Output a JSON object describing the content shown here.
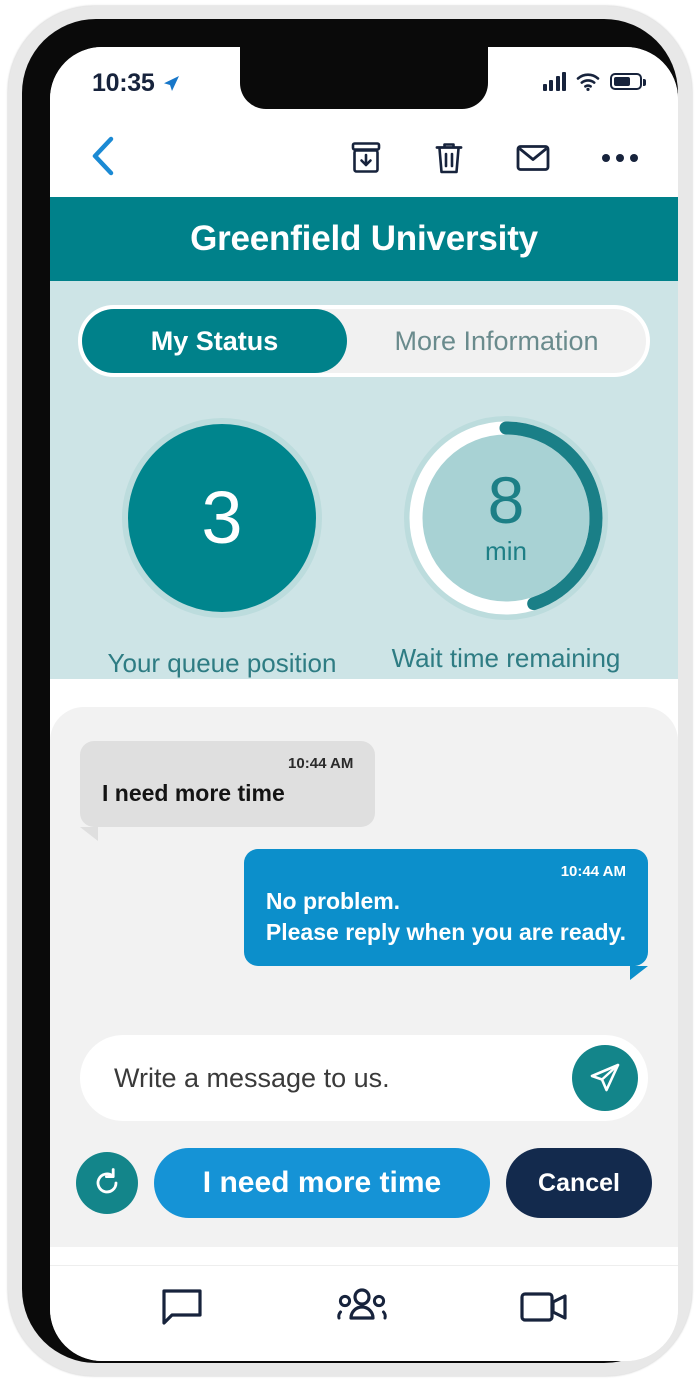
{
  "status_bar": {
    "time": "10:35",
    "location_icon": "location-arrow-icon",
    "signal_icon": "cellular-signal-icon",
    "wifi_icon": "wifi-icon",
    "battery_icon": "battery-icon"
  },
  "toolbar": {
    "back_icon": "chevron-left-icon",
    "archive_icon": "archive-box-icon",
    "delete_icon": "trash-icon",
    "mail_icon": "envelope-icon",
    "more_icon": "ellipsis-icon"
  },
  "header": {
    "title": "Greenfield University"
  },
  "tabs": [
    {
      "label": "My Status",
      "active": true
    },
    {
      "label": "More Information",
      "active": false
    }
  ],
  "metrics": [
    {
      "value": "3",
      "unit": "",
      "label": "Your queue position",
      "type": "solid"
    },
    {
      "value": "8",
      "unit": "min",
      "label": "Wait time remaining",
      "type": "ring",
      "progress_percent": 45
    }
  ],
  "chat": {
    "messages": [
      {
        "direction": "incoming",
        "time": "10:44 AM",
        "text": "I need more time"
      },
      {
        "direction": "outgoing",
        "time": "10:44 AM",
        "line1": "No problem.",
        "line2": "Please reply when you are ready."
      }
    ],
    "composer": {
      "placeholder": "Write a message to us.",
      "value": "",
      "send_icon": "send-paper-plane-icon"
    },
    "actions": {
      "refresh_icon": "refresh-icon",
      "primary_label": "I need more time",
      "cancel_label": "Cancel"
    }
  },
  "bottom_nav": [
    {
      "icon": "chat-bubble-icon",
      "name": "messages"
    },
    {
      "icon": "people-group-icon",
      "name": "contacts"
    },
    {
      "icon": "video-camera-icon",
      "name": "video"
    }
  ],
  "colors": {
    "brand_teal": "#00818a",
    "panel_teal": "#cde4e6",
    "bubble_blue": "#0c8fcb",
    "action_blue": "#1593d6",
    "cancel_navy": "#132a4d",
    "chat_bg": "#f2f2f2"
  }
}
